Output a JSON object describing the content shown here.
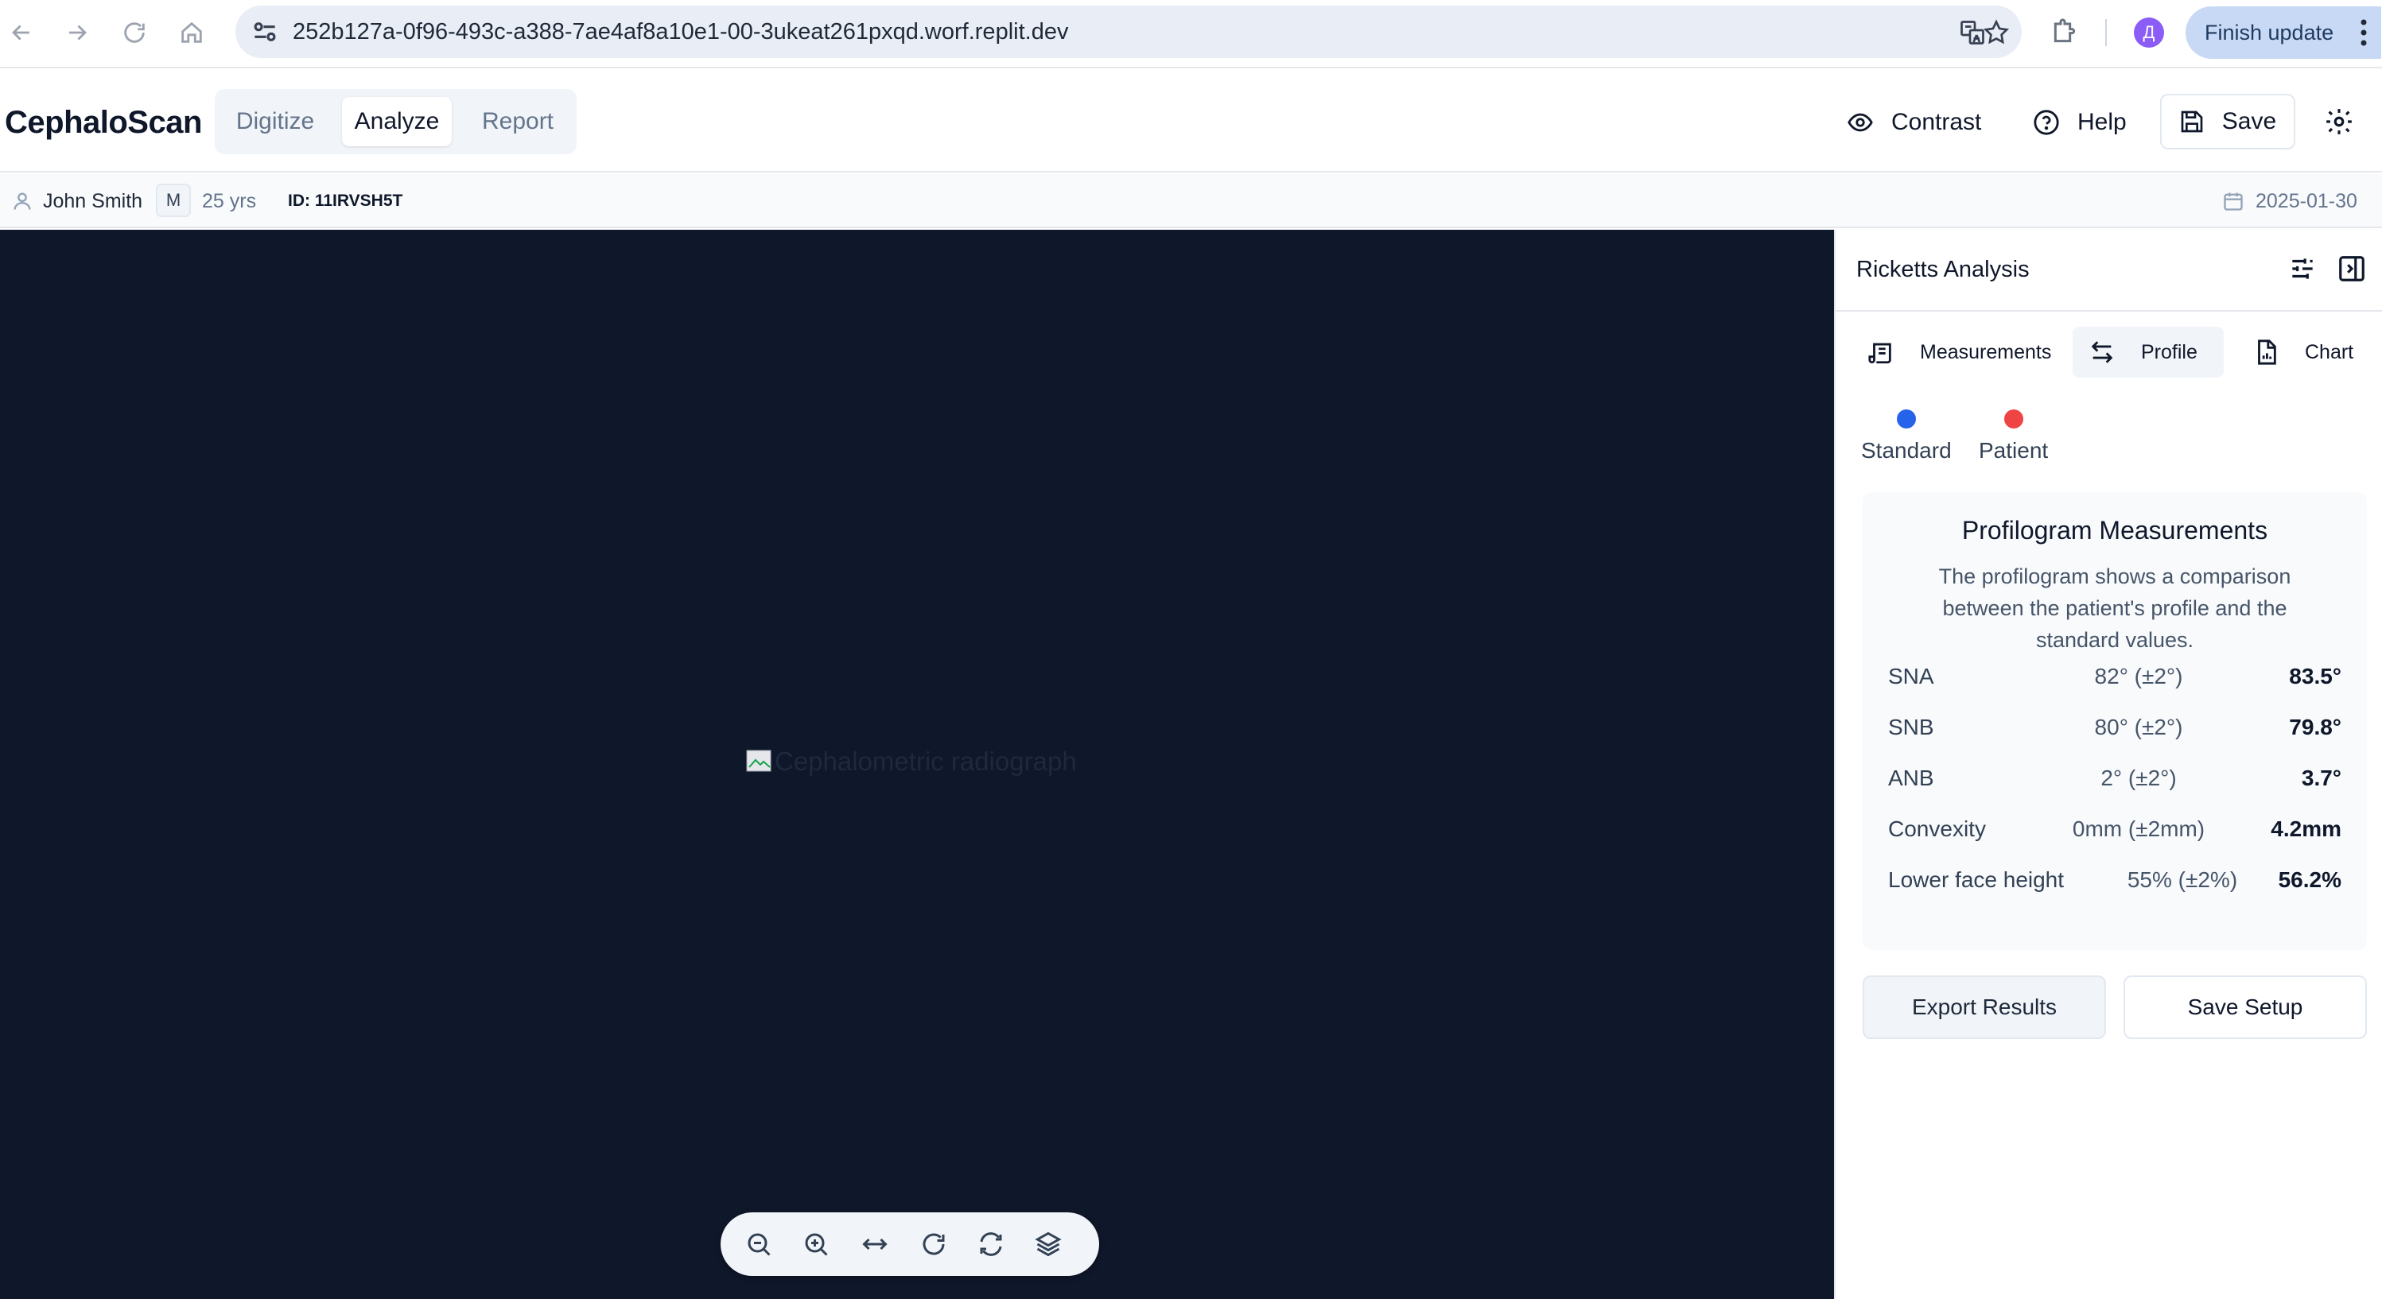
{
  "browser": {
    "url": "252b127a-0f96-493c-a388-7ae4af8a10e1-00-3ukeat261pxqd.worf.replit.dev",
    "profile_initial": "Д",
    "finish_update_label": "Finish update"
  },
  "header": {
    "brand": "CephaloScan",
    "modes": [
      "Digitize",
      "Analyze",
      "Report"
    ],
    "active_mode": "Analyze",
    "contrast_label": "Contrast",
    "help_label": "Help",
    "save_label": "Save"
  },
  "patient": {
    "name": "John Smith",
    "sex": "M",
    "age": "25 yrs",
    "id": "ID: 11IRVSH5T",
    "date": "2025-01-30"
  },
  "viewer": {
    "image_alt": "Cephalometric radiograph",
    "background": "#0f172a",
    "tools": [
      "zoom-out-icon",
      "zoom-in-icon",
      "fit-width-icon",
      "rotate-icon",
      "reset-icon",
      "layers-icon"
    ]
  },
  "panel": {
    "title": "Ricketts Analysis",
    "tabs": [
      "Measurements",
      "Profile",
      "Chart"
    ],
    "active_tab": "Profile",
    "legend": [
      {
        "label": "Standard",
        "color": "#2563eb"
      },
      {
        "label": "Patient",
        "color": "#ef4444"
      }
    ],
    "card": {
      "title": "Profilogram Measurements",
      "description": "The profilogram shows a comparison between the patient's profile and the standard values.",
      "rows": [
        {
          "name": "SNA",
          "norm": "82° (±2°)",
          "value": "83.5°"
        },
        {
          "name": "SNB",
          "norm": "80° (±2°)",
          "value": "79.8°"
        },
        {
          "name": "ANB",
          "norm": "2° (±2°)",
          "value": "3.7°"
        },
        {
          "name": "Convexity",
          "norm": "0mm (±2mm)",
          "value": "4.2mm"
        },
        {
          "name": "Lower face height",
          "norm": "55% (±2%)",
          "value": "56.2%"
        }
      ]
    },
    "export_label": "Export Results",
    "save_setup_label": "Save Setup"
  }
}
